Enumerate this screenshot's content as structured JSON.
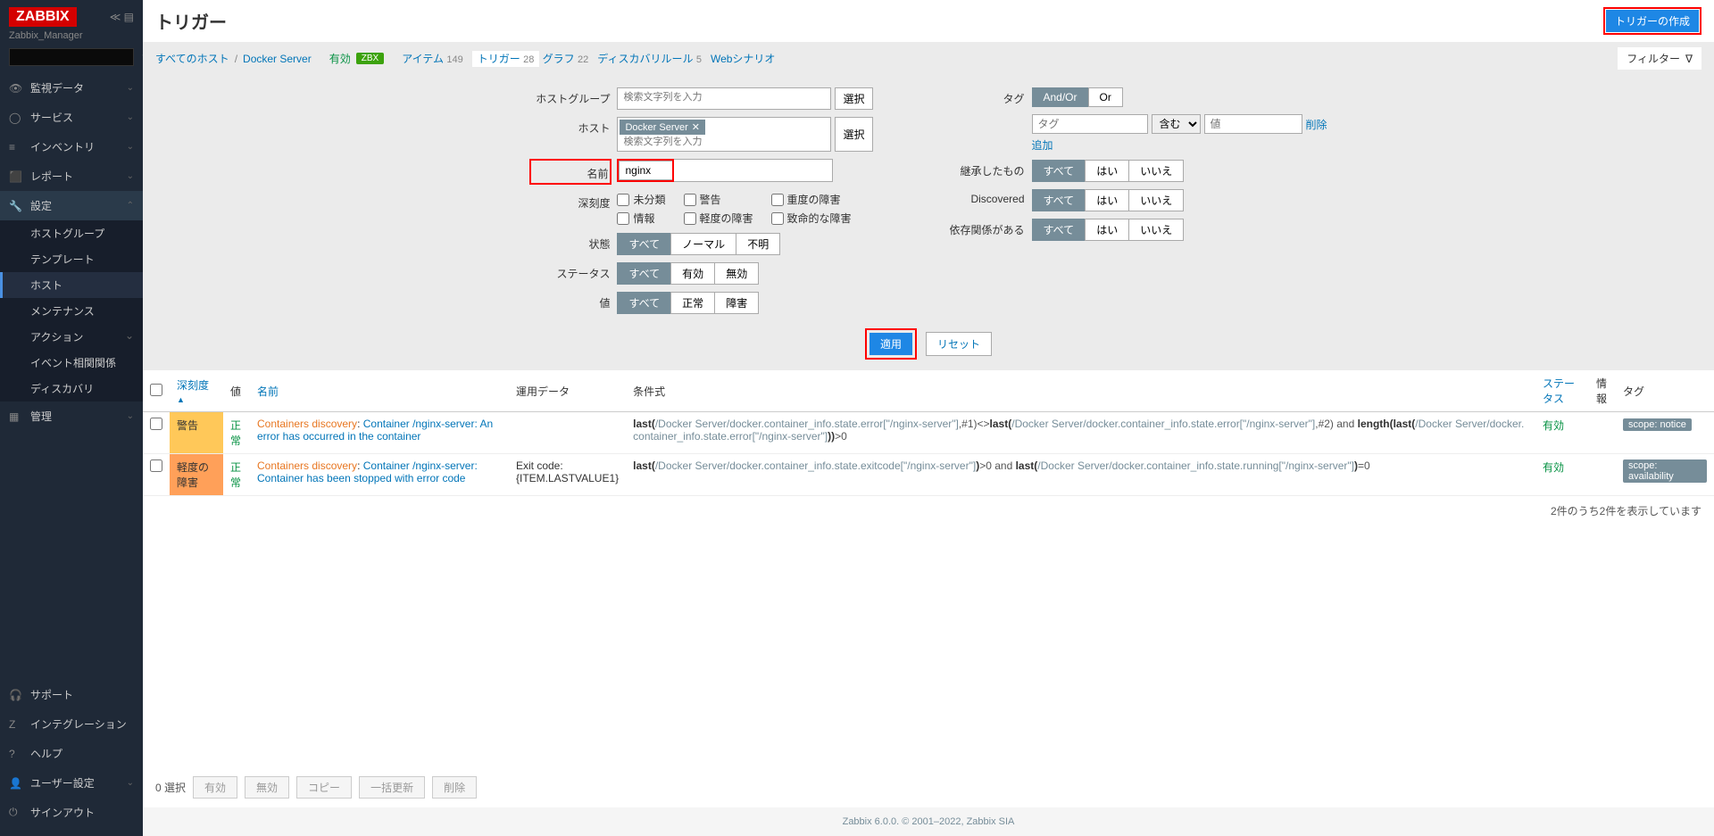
{
  "brand": "ZABBIX",
  "server_name": "Zabbix_Manager",
  "page_title": "トリガー",
  "create_btn": "トリガーの作成",
  "sidebar": {
    "main": [
      {
        "icon": "👁",
        "label": "監視データ",
        "chev": true
      },
      {
        "icon": "◯",
        "label": "サービス",
        "chev": true
      },
      {
        "icon": "≡",
        "label": "インベントリ",
        "chev": true
      },
      {
        "icon": "⬛",
        "label": "レポート",
        "chev": true
      },
      {
        "icon": "🔧",
        "label": "設定",
        "chev": true,
        "open": true
      },
      {
        "icon": "▦",
        "label": "管理",
        "chev": true
      }
    ],
    "settings_sub": [
      {
        "label": "ホストグループ"
      },
      {
        "label": "テンプレート"
      },
      {
        "label": "ホスト",
        "active": true
      },
      {
        "label": "メンテナンス"
      },
      {
        "label": "アクション",
        "chev": true
      },
      {
        "label": "イベント相関関係"
      },
      {
        "label": "ディスカバリ"
      }
    ],
    "bottom": [
      {
        "icon": "🎧",
        "label": "サポート"
      },
      {
        "icon": "Z",
        "label": "インテグレーション"
      },
      {
        "icon": "?",
        "label": "ヘルプ"
      },
      {
        "icon": "👤",
        "label": "ユーザー設定",
        "chev": true
      },
      {
        "icon": "⏻",
        "label": "サインアウト"
      }
    ]
  },
  "breadcrumb": {
    "all_hosts": "すべてのホスト",
    "host": "Docker Server",
    "enabled": "有効",
    "zbx": "ZBX",
    "items": [
      {
        "label": "アイテム",
        "count": "149"
      },
      {
        "label": "トリガー",
        "count": "28",
        "active": true
      },
      {
        "label": "グラフ",
        "count": "22"
      },
      {
        "label": "ディスカバリルール",
        "count": "5"
      },
      {
        "label": "Webシナリオ",
        "count": ""
      }
    ]
  },
  "filter_tab": "フィルター",
  "filter": {
    "host_group_label": "ホストグループ",
    "host_group_placeholder": "検索文字列を入力",
    "host_label": "ホスト",
    "host_placeholder": "検索文字列を入力",
    "host_selected": "Docker Server",
    "select_btn": "選択",
    "name_label": "名前",
    "name_value": "nginx",
    "severity_label": "深刻度",
    "severities": [
      "未分類",
      "警告",
      "重度の障害",
      "情報",
      "軽度の障害",
      "致命的な障害"
    ],
    "state_label": "状態",
    "state_opts": [
      "すべて",
      "ノーマル",
      "不明"
    ],
    "status_label": "ステータス",
    "status_opts": [
      "すべて",
      "有効",
      "無効"
    ],
    "value_label": "値",
    "value_opts": [
      "すべて",
      "正常",
      "障害"
    ],
    "tag_label": "タグ",
    "tag_opts": [
      "And/Or",
      "Or"
    ],
    "tag_placeholder": "タグ",
    "tag_op": "含む",
    "tag_val_placeholder": "値",
    "tag_remove": "削除",
    "tag_add": "追加",
    "inherited_label": "継承したもの",
    "discovered_label": "Discovered",
    "depends_label": "依存関係がある",
    "yesno_opts": [
      "すべて",
      "はい",
      "いいえ"
    ],
    "apply_btn": "適用",
    "reset_btn": "リセット"
  },
  "table": {
    "cols": {
      "severity": "深刻度",
      "value": "値",
      "name": "名前",
      "opdata": "運用データ",
      "expression": "条件式",
      "status": "ステータス",
      "info": "情報",
      "tags": "タグ"
    },
    "rows": [
      {
        "severity": "警告",
        "sev_class": "sev-warning",
        "value": "正常",
        "name_prefix": "Containers discovery",
        "name_link": "Container /nginx-server: An error has occurred in the container",
        "opdata": "",
        "expr_html": "<b>last(</b><span class='path'>/Docker Server/docker.container_info.state.error[\"/nginx-server\"]</span>,#1)<><b>last(</b><span class='path'>/Docker Server/docker.container_info.state.error[\"/nginx-server\"]</span>,#2) and <b>length(last(</b><span class='path'>/Docker Server/docker.container_info.state.error[\"/nginx-server\"]</span><b>))</b>>0",
        "status": "有効",
        "tags": [
          "scope: notice"
        ]
      },
      {
        "severity": "軽度の障害",
        "sev_class": "sev-average",
        "value": "正常",
        "name_prefix": "Containers discovery",
        "name_link": "Container /nginx-server: Container has been stopped with error code",
        "opdata": "Exit code: {ITEM.LASTVALUE1}",
        "expr_html": "<b>last(</b><span class='path'>/Docker Server/docker.container_info.state.exitcode[\"/nginx-server\"]</span><b>)</b>>0 and <b>last(</b><span class='path'>/Docker Server/docker.container_info.state.running[\"/nginx-server\"]</span><b>)</b>=0",
        "status": "有効",
        "tags": [
          "scope: availability"
        ]
      }
    ],
    "footer": "2件のうち2件を表示しています"
  },
  "bulk": {
    "selected": "0 選択",
    "enable": "有効",
    "disable": "無効",
    "copy": "コピー",
    "massupdate": "一括更新",
    "delete": "削除"
  },
  "footer": "Zabbix 6.0.0. © 2001–2022, Zabbix SIA"
}
